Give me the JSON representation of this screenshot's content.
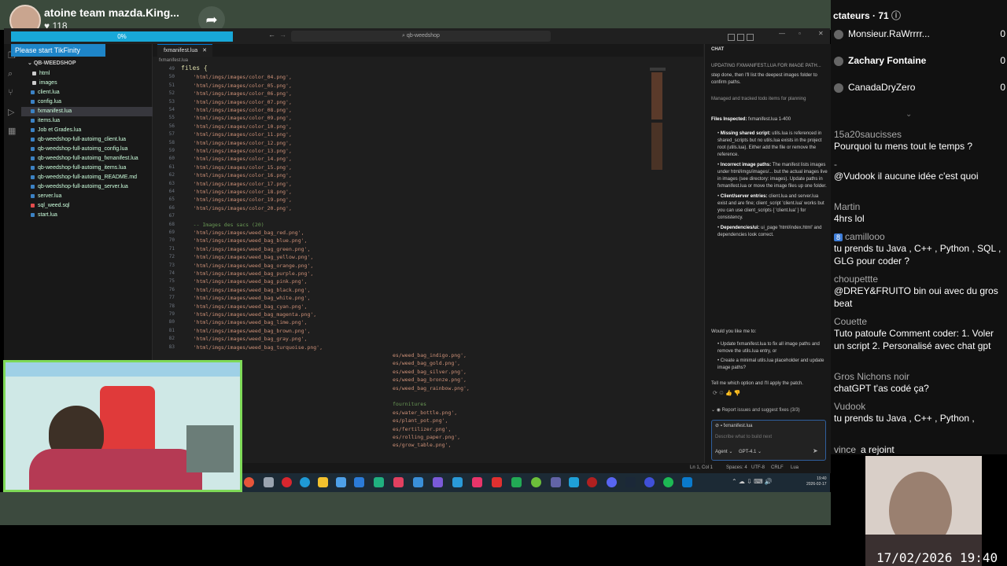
{
  "stream": {
    "streamer_name": "atoine team mazda.King...",
    "likes": "118",
    "progress_label": "0%",
    "progress_fraction": 0,
    "tikfinity_notice": "Please start TikFinity"
  },
  "vscode": {
    "search_text": "qb-weedshop",
    "explorer": {
      "root": "QB-WEEDSHOP",
      "items": [
        {
          "label": "html",
          "color": "#cccccc"
        },
        {
          "label": "images",
          "color": "#cccccc"
        },
        {
          "label": "client.lua",
          "color": "#3b82c4"
        },
        {
          "label": "config.lua",
          "color": "#3b82c4"
        },
        {
          "label": "fxmanifest.lua",
          "color": "#3b82c4"
        },
        {
          "label": "items.lua",
          "color": "#3b82c4"
        },
        {
          "label": "Job et Grades.lua",
          "color": "#3b82c4"
        },
        {
          "label": "qb-weedshop-full-autoimg_client.lua",
          "color": "#3b82c4"
        },
        {
          "label": "qb-weedshop-full-autoimg_config.lua",
          "color": "#3b82c4"
        },
        {
          "label": "qb-weedshop-full-autoimg_fxmanifest.lua",
          "color": "#3b82c4"
        },
        {
          "label": "qb-weedshop-full-autoimg_items.lua",
          "color": "#3b82c4"
        },
        {
          "label": "qb-weedshop-full-autoimg_README.md",
          "color": "#3b82c4"
        },
        {
          "label": "qb-weedshop-full-autoimg_server.lua",
          "color": "#3b82c4"
        },
        {
          "label": "server.lua",
          "color": "#3b82c4"
        },
        {
          "label": "sql_weed.sql",
          "color": "#e34c4c"
        },
        {
          "label": "start.lua",
          "color": "#3b82c4"
        }
      ]
    },
    "tab_label": "fxmanifest.lua",
    "breadcrumb": "fxmanifest.lua",
    "code_lines": [
      {
        "n": "49",
        "t": "files {"
      },
      {
        "n": "50",
        "t": "    'html/imgs/images/color_04.png',"
      },
      {
        "n": "51",
        "t": "    'html/imgs/images/color_05.png',"
      },
      {
        "n": "52",
        "t": "    'html/imgs/images/color_06.png',"
      },
      {
        "n": "53",
        "t": "    'html/imgs/images/color_07.png',"
      },
      {
        "n": "54",
        "t": "    'html/imgs/images/color_08.png',"
      },
      {
        "n": "55",
        "t": "    'html/imgs/images/color_09.png',"
      },
      {
        "n": "56",
        "t": "    'html/imgs/images/color_10.png',"
      },
      {
        "n": "57",
        "t": "    'html/imgs/images/color_11.png',"
      },
      {
        "n": "58",
        "t": "    'html/imgs/images/color_12.png',"
      },
      {
        "n": "59",
        "t": "    'html/imgs/images/color_13.png',"
      },
      {
        "n": "60",
        "t": "    'html/imgs/images/color_14.png',"
      },
      {
        "n": "61",
        "t": "    'html/imgs/images/color_15.png',"
      },
      {
        "n": "62",
        "t": "    'html/imgs/images/color_16.png',"
      },
      {
        "n": "63",
        "t": "    'html/imgs/images/color_17.png',"
      },
      {
        "n": "64",
        "t": "    'html/imgs/images/color_18.png',"
      },
      {
        "n": "65",
        "t": "    'html/imgs/images/color_19.png',"
      },
      {
        "n": "66",
        "t": "    'html/imgs/images/color_20.png',"
      },
      {
        "n": "67",
        "t": ""
      },
      {
        "n": "68",
        "t": "    -- Images des sacs (20)"
      },
      {
        "n": "69",
        "t": "    'html/imgs/images/weed_bag_red.png',"
      },
      {
        "n": "70",
        "t": "    'html/imgs/images/weed_bag_blue.png',"
      },
      {
        "n": "71",
        "t": "    'html/imgs/images/weed_bag_green.png',"
      },
      {
        "n": "72",
        "t": "    'html/imgs/images/weed_bag_yellow.png',"
      },
      {
        "n": "73",
        "t": "    'html/imgs/images/weed_bag_orange.png',"
      },
      {
        "n": "74",
        "t": "    'html/imgs/images/weed_bag_purple.png',"
      },
      {
        "n": "75",
        "t": "    'html/imgs/images/weed_bag_pink.png',"
      },
      {
        "n": "76",
        "t": "    'html/imgs/images/weed_bag_black.png',"
      },
      {
        "n": "77",
        "t": "    'html/imgs/images/weed_bag_white.png',"
      },
      {
        "n": "78",
        "t": "    'html/imgs/images/weed_bag_cyan.png',"
      },
      {
        "n": "79",
        "t": "    'html/imgs/images/weed_bag_magenta.png',"
      },
      {
        "n": "80",
        "t": "    'html/imgs/images/weed_bag_lime.png',"
      },
      {
        "n": "81",
        "t": "    'html/imgs/images/weed_bag_brown.png',"
      },
      {
        "n": "82",
        "t": "    'html/imgs/images/weed_bag_gray.png',"
      },
      {
        "n": "83",
        "t": "    'html/imgs/images/weed_bag_turquoise.png',"
      }
    ],
    "code_lines_partial": [
      "es/weed_bag_indigo.png',",
      "es/weed_bag_gold.png',",
      "es/weed_bag_silver.png',",
      "es/weed_bag_bronze.png',",
      "es/weed_bag_rainbow.png',",
      "",
      "fournitures",
      "es/water_bottle.png',",
      "es/plant_pot.png',",
      "es/fertilizer.png',",
      "es/rolling_paper.png',",
      "es/grow_table.png',"
    ],
    "chat": {
      "tab": "CHAT",
      "header": "UPDATING FXMANIFEST.LUA FOR IMAGE PATH...",
      "intro": "step done, then I'll list the deepest images folder to confirm paths.",
      "todo": "Managed and tracked todo items for planning",
      "files_inspected_label": "Files Inspected:",
      "files_inspected_value": "fxmanifest.lua 1-400",
      "findings": [
        {
          "title": "Missing shared script:",
          "text": "utils.lua is referenced in shared_scripts but no utils.lua exists in the project root (utils.lua). Either add the file or remove the reference."
        },
        {
          "title": "Incorrect image paths:",
          "text": "The manifest lists images under html/imgs/images/... but the actual images live in images (see directory: images). Update paths in fxmanifest.lua or move the image files up one folder."
        },
        {
          "title": "Client/server entries:",
          "text": "client.lua and server.lua exist and are fine; client_script 'client.lua' works but you can use client_scripts { 'client.lua' } for consistency."
        },
        {
          "title": "Dependencies/ui:",
          "text": "ui_page 'html/index.html' and dependencies look correct."
        }
      ],
      "question": "Would you like me to:",
      "options": [
        "Update fxmanifest.lua to fix all image paths and remove the utils.lua entry, or",
        "Create a minimal utils.lua placeholder and update image paths?"
      ],
      "closing": "Tell me which option and I'll apply the patch.",
      "task_label": "Report issues and suggest fixes (3/3)",
      "context_file": "fxmanifest.lua",
      "input_placeholder": "Describe what to build next",
      "mode": "Agent",
      "model": "GPT-4.1"
    },
    "status": {
      "position": "Ln 1, Col 1",
      "spaces": "Spaces: 4",
      "encoding": "UTF-8",
      "eol": "CRLF",
      "language": "Lua"
    }
  },
  "taskbar": {
    "time": "19:40",
    "date": "2026-02-17"
  },
  "sidebar": {
    "viewers_label": "ctateurs · 71",
    "top_viewers": [
      {
        "name": "Monsieur.RaWrrrr...",
        "score": "0"
      },
      {
        "name": "Zachary Fontaine",
        "score": "0"
      },
      {
        "name": "CanadaDryZero",
        "score": "0"
      }
    ],
    "messages": [
      {
        "user": "15a20saucisses",
        "badge": "",
        "text": "Pourquoi tu mens tout le temps ?"
      },
      {
        "user": "-",
        "badge": "",
        "text": "@Vudook il aucune idée c'est quoi"
      },
      {
        "user": "Martin",
        "badge": "",
        "text": "4hrs lol"
      },
      {
        "user": "camillooo",
        "badge": "8",
        "text": "tu prends tu Java , C++ , Python , SQL , GLG pour coder ?"
      },
      {
        "user": "choupettte",
        "badge": "",
        "text": "@DREY&FRUITO bin oui avec du gros beat"
      },
      {
        "user": "Couette",
        "badge": "",
        "text": "Tuto patoufe Comment coder: 1. Voler un script 2. Personalisé avec chat gpt"
      },
      {
        "user": "Gros Nichons noir",
        "badge": "",
        "text": "chatGPT t'as codé ça?"
      },
      {
        "user": "Vudook",
        "badge": "",
        "text": "tu prends tu Java , C++ , Python ,"
      },
      {
        "user": "vince",
        "badge": "",
        "text": "a rejoint"
      }
    ]
  },
  "overlay": {
    "timestamp": "17/02/2026 19:40"
  }
}
